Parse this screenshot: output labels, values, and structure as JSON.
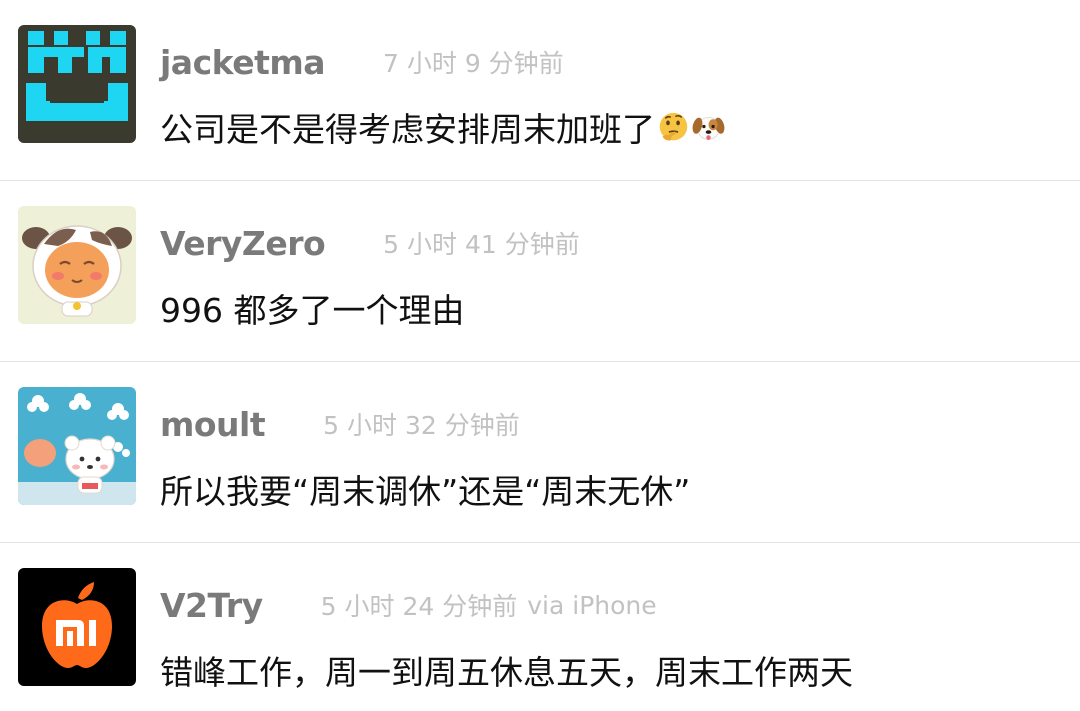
{
  "comments": [
    {
      "username": "jacketma",
      "time": "7 小时 9 分钟前",
      "via": "",
      "content": "公司是不是得考虑安排周末加班了",
      "avatar_icon": "pixel-face-avatar",
      "emojis": [
        "thinking-face-emoji",
        "dog-face-emoji"
      ]
    },
    {
      "username": "VeryZero",
      "time": "5 小时 41 分钟前",
      "via": "",
      "content": "996 都多了一个理由",
      "avatar_icon": "cartoon-cow-avatar",
      "emojis": []
    },
    {
      "username": "moult",
      "time": "5 小时 32 分钟前",
      "via": "",
      "content": "所以我要“周末调休”还是“周末无休”",
      "avatar_icon": "cartoon-bear-avatar",
      "emojis": []
    },
    {
      "username": "V2Try",
      "time": "5 小时 24 分钟前",
      "via": "via iPhone",
      "content": "错峰工作，周一到周五休息五天，周末工作两天",
      "avatar_icon": "mi-apple-logo-avatar",
      "emojis": []
    }
  ]
}
